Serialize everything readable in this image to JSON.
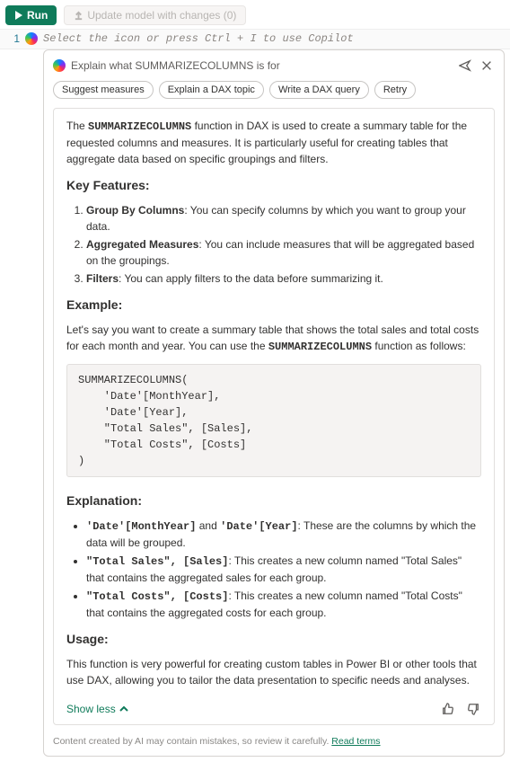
{
  "topbar": {
    "run_label": "Run",
    "update_label": "Update model with changes (0)"
  },
  "editor": {
    "line_number": "1",
    "placeholder": "Select the icon or press Ctrl + I to use Copilot"
  },
  "panel": {
    "input_value": "Explain what SUMMARIZECOLUMNS is for",
    "chips": [
      "Suggest measures",
      "Explain a DAX topic",
      "Write a DAX query",
      "Retry"
    ]
  },
  "content": {
    "intro_pre": "The ",
    "intro_fn": "SUMMARIZECOLUMNS",
    "intro_post": " function in DAX is used to create a summary table for the requested columns and measures. It is particularly useful for creating tables that aggregate data based on specific groupings and filters.",
    "h_features": "Key Features:",
    "f1_b": "Group By Columns",
    "f1_t": ": You can specify columns by which you want to group your data.",
    "f2_b": "Aggregated Measures",
    "f2_t": ": You can include measures that will be aggregated based on the groupings.",
    "f3_b": "Filters",
    "f3_t": ": You can apply filters to the data before summarizing it.",
    "h_example": "Example:",
    "example_pre": "Let's say you want to create a summary table that shows the total sales and total costs for each month and year. You can use the ",
    "example_fn": "SUMMARIZECOLUMNS",
    "example_post": " function as follows:",
    "code": "SUMMARIZECOLUMNS(\n    'Date'[MonthYear],\n    'Date'[Year],\n    \"Total Sales\", [Sales],\n    \"Total Costs\", [Costs]\n)",
    "h_explanation": "Explanation:",
    "e1_c1": "'Date'[MonthYear]",
    "e1_mid": " and ",
    "e1_c2": "'Date'[Year]",
    "e1_t": ": These are the columns by which the data will be grouped.",
    "e2_c": "\"Total Sales\", [Sales]",
    "e2_t": ": This creates a new column named \"Total Sales\" that contains the aggregated sales for each group.",
    "e3_c": "\"Total Costs\", [Costs]",
    "e3_t": ": This creates a new column named \"Total Costs\" that contains the aggregated costs for each group.",
    "h_usage": "Usage:",
    "usage_text": "This function is very powerful for creating custom tables in Power BI or other tools that use DAX, allowing you to tailor the data presentation to specific needs and analyses.",
    "show_less": "Show less"
  },
  "footer": {
    "text": "Content created by AI may contain mistakes, so review it carefully. ",
    "link": "Read terms"
  }
}
